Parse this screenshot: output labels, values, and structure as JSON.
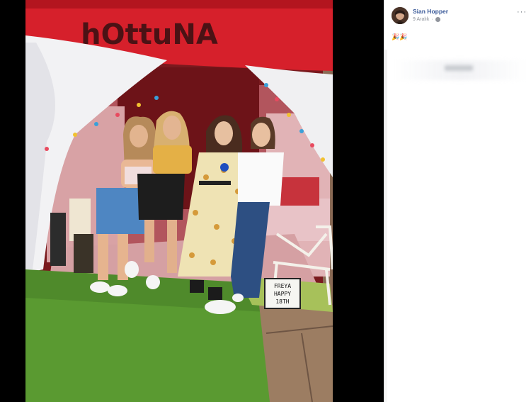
{
  "post": {
    "author": "Sian Hopper",
    "date": "9 Aralık",
    "separator": "·",
    "caption": "🎉🎉",
    "more_label": "···"
  },
  "photo": {
    "banner_text": "hOttuNA",
    "sign_line1": "FREYA",
    "sign_line2": "HAPPY",
    "sign_line3": "18TH"
  },
  "icons": {
    "privacy": "globe-icon",
    "menu": "more-options-icon"
  },
  "colors": {
    "link": "#385898",
    "muted": "#90949c",
    "banner": "#d6202b"
  }
}
